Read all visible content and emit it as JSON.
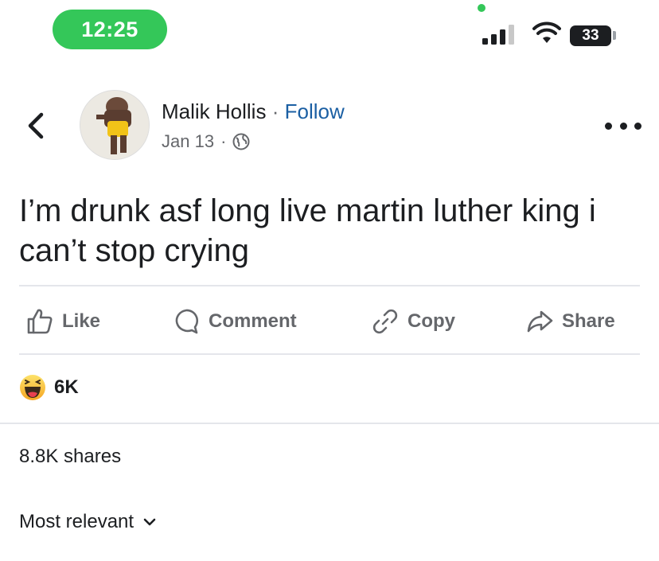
{
  "status_bar": {
    "time": "12:25",
    "battery": "33",
    "accent_color": "#34c759"
  },
  "post": {
    "author": "Malik Hollis",
    "separator": "·",
    "follow_label": "Follow",
    "date": "Jan 13",
    "meta_separator": "·",
    "privacy_icon": "globe-icon",
    "text": "I’m drunk asf long live martin luther king i can’t stop crying"
  },
  "actions": [
    {
      "label": "Like",
      "icon": "thumbs-up-icon"
    },
    {
      "label": "Comment",
      "icon": "comment-icon"
    },
    {
      "label": "Copy",
      "icon": "link-icon"
    },
    {
      "label": "Share",
      "icon": "share-icon"
    }
  ],
  "reactions": {
    "icon": "haha-emoji-icon",
    "count": "6K"
  },
  "shares_text": "8.8K shares",
  "comments_sort": {
    "label": "Most relevant",
    "icon": "chevron-down-icon"
  },
  "colors": {
    "link_blue": "#1b5fa3",
    "secondary_text": "#65676b",
    "divider": "#e4e6eb"
  }
}
